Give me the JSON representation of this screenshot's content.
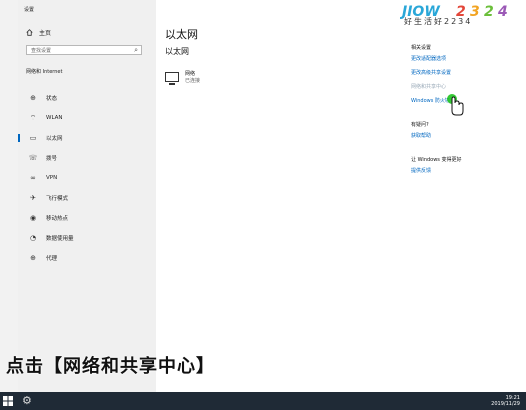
{
  "window": {
    "title": "设置"
  },
  "watermark": {
    "logo_text": "JIOW2324",
    "slogan": "好生活好2234"
  },
  "sidebar": {
    "home_label": "主页",
    "search_placeholder": "查找设置",
    "section_title": "网络和 Internet",
    "items": [
      {
        "label": "状态",
        "icon": "status-icon"
      },
      {
        "label": "WLAN",
        "icon": "wifi-icon"
      },
      {
        "label": "以太网",
        "icon": "ethernet-icon",
        "active": true
      },
      {
        "label": "拨号",
        "icon": "dialup-icon"
      },
      {
        "label": "VPN",
        "icon": "vpn-icon"
      },
      {
        "label": "飞行模式",
        "icon": "airplane-icon"
      },
      {
        "label": "移动热点",
        "icon": "hotspot-icon"
      },
      {
        "label": "数据使用量",
        "icon": "data-usage-icon"
      },
      {
        "label": "代理",
        "icon": "proxy-icon"
      }
    ]
  },
  "main": {
    "title": "以太网",
    "subtitle": "以太网",
    "network": {
      "name": "网络",
      "status": "已连接"
    }
  },
  "related": {
    "title": "相关设置",
    "links": [
      "更改适配器选项",
      "更改高级共享设置",
      "网络和共享中心",
      "Windows 防火墙"
    ],
    "help_title": "有疑问?",
    "help_link": "获取帮助",
    "improve_title": "让 Windows 变得更好",
    "improve_link": "提供反馈"
  },
  "caption": "点击【网络和共享中心】",
  "taskbar": {
    "time": "19:21",
    "date": "2019/11/29"
  },
  "colors": {
    "accent": "#0067c0",
    "taskbar": "#1f2a36",
    "sidebar": "#f0f0f0"
  }
}
